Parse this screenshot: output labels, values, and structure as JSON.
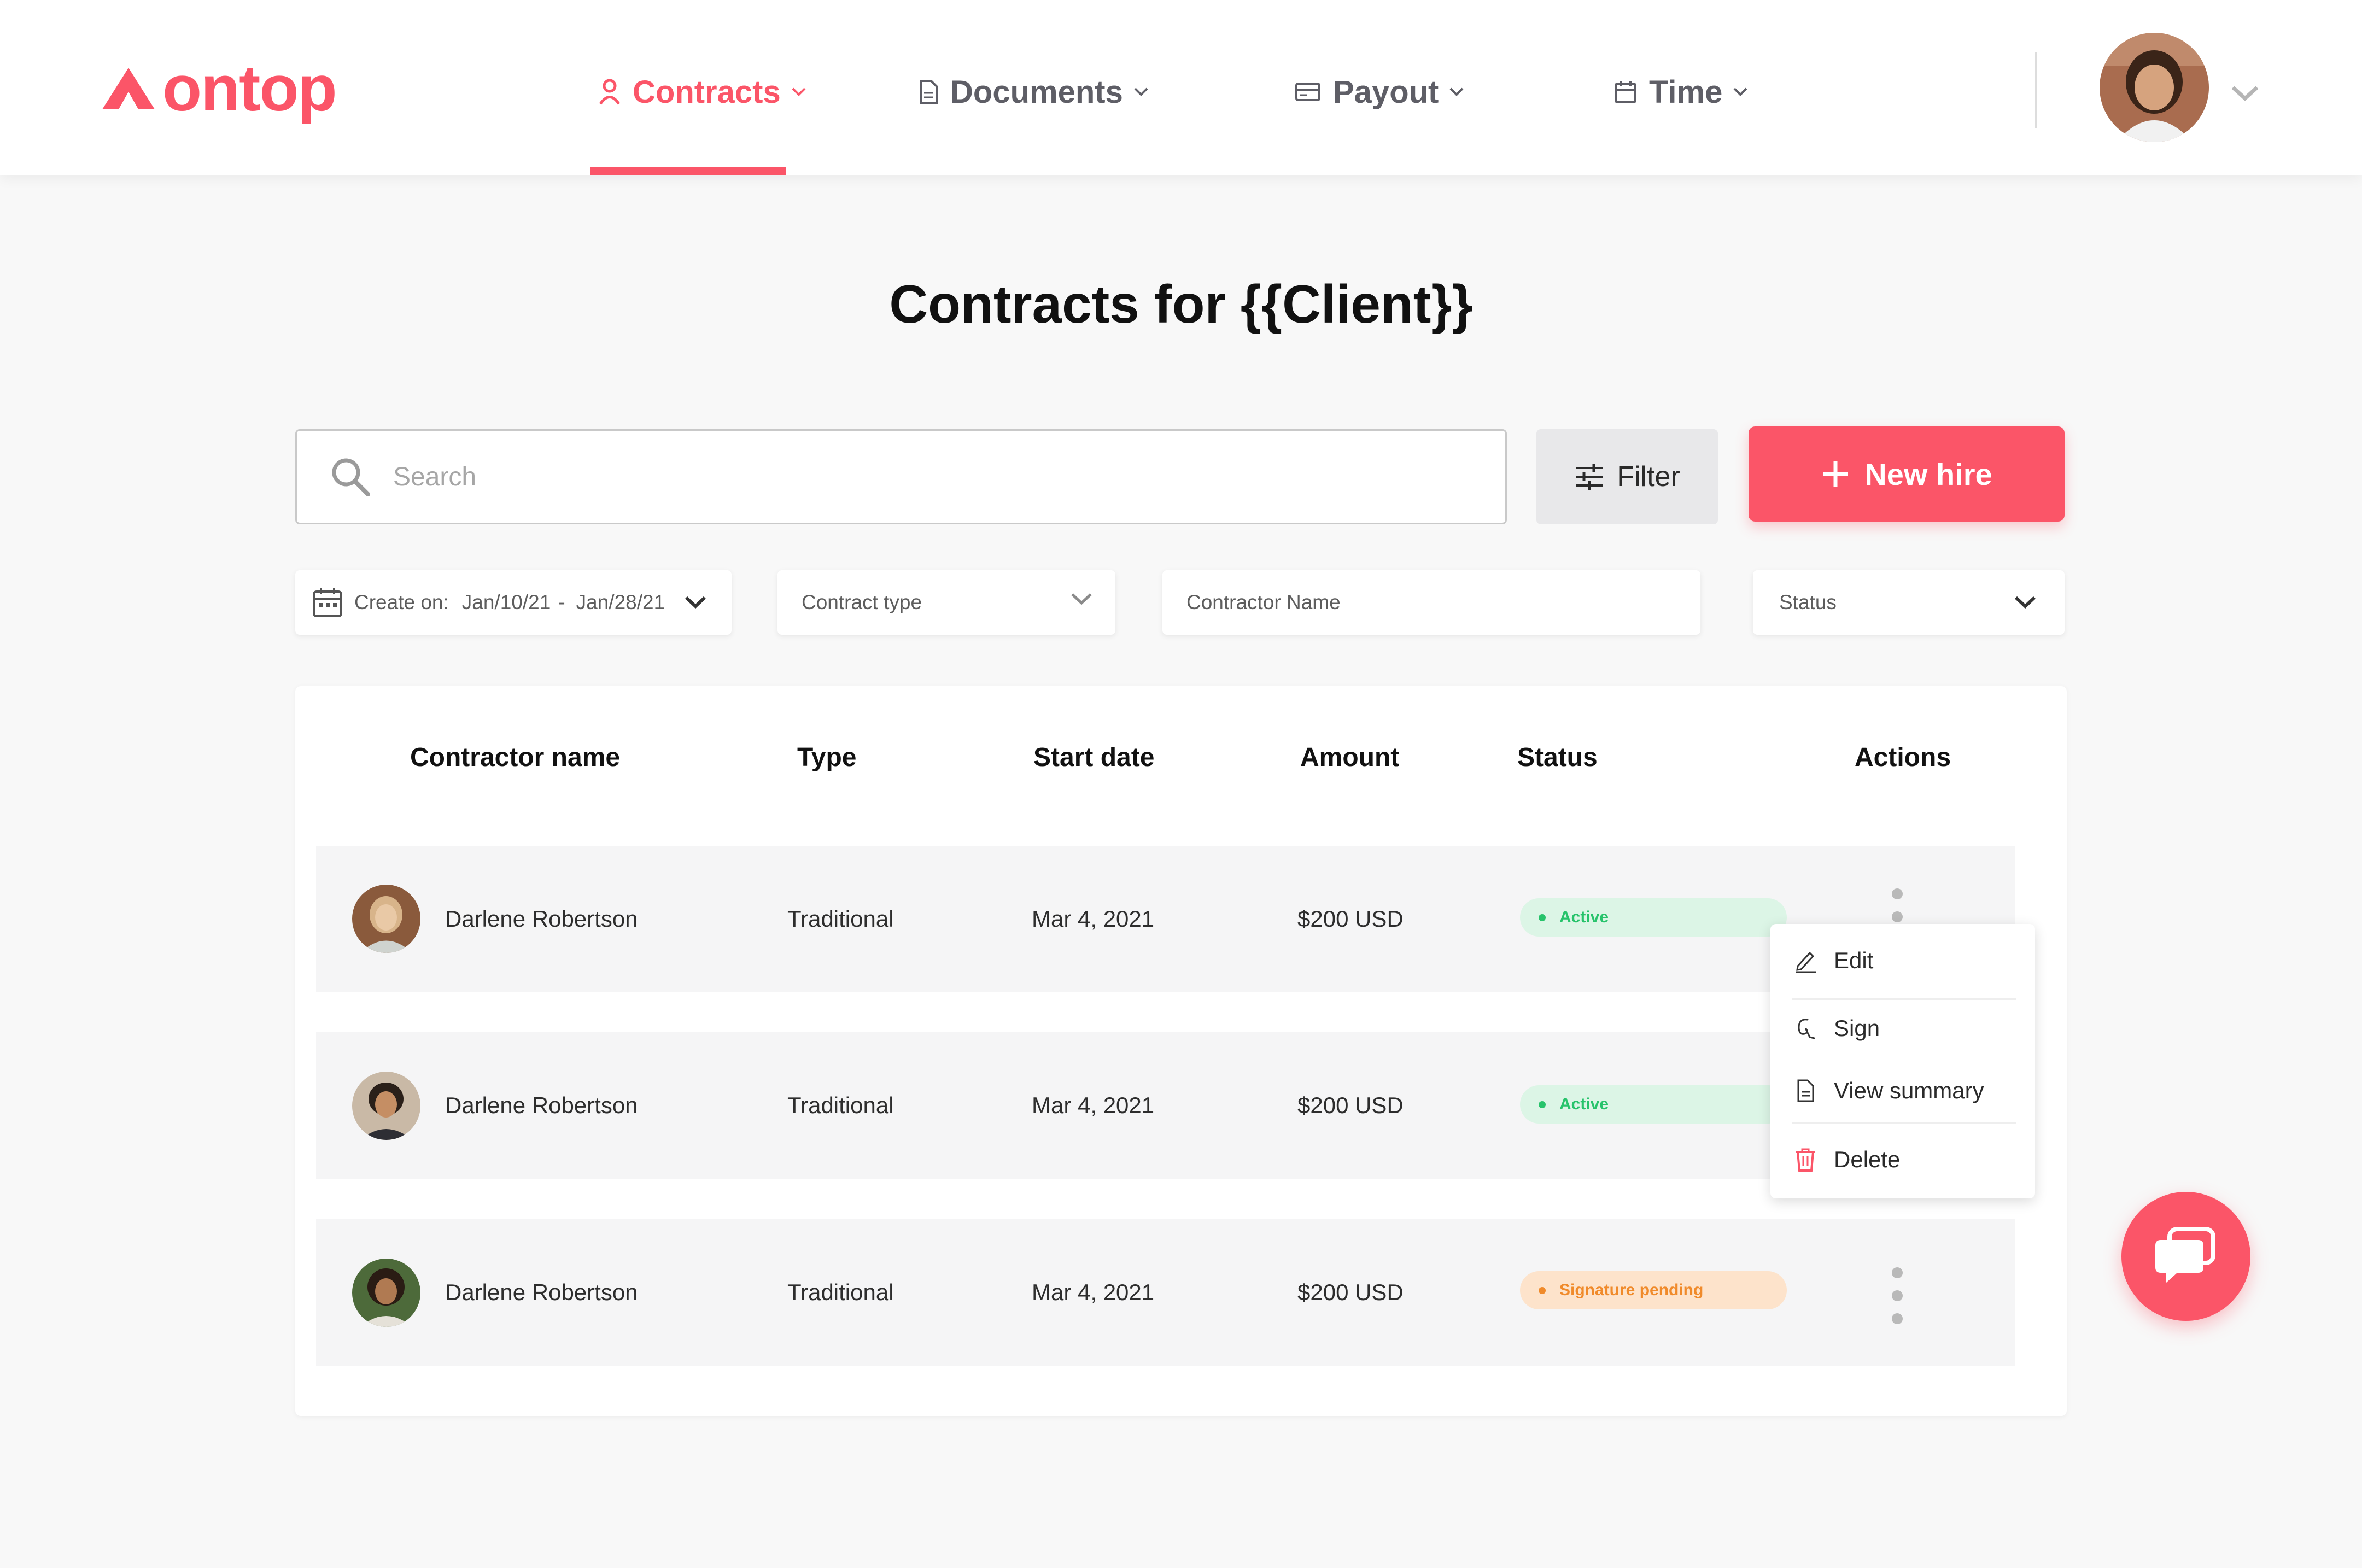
{
  "brand": {
    "name": "ontop",
    "accent": "#fb5568"
  },
  "nav": {
    "items": [
      {
        "label": "Contracts",
        "icon": "person-icon",
        "active": true
      },
      {
        "label": "Documents",
        "icon": "document-icon",
        "active": false
      },
      {
        "label": "Payout",
        "icon": "card-icon",
        "active": false
      },
      {
        "label": "Time",
        "icon": "calendar-icon",
        "active": false
      }
    ]
  },
  "page": {
    "title": "Contracts for {{Client}}"
  },
  "toolbar": {
    "search_placeholder": "Search",
    "filter_label": "Filter",
    "new_hire_label": "New hire"
  },
  "filters": {
    "created_on_label": "Create on:",
    "date_from": "Jan/10/21",
    "date_sep": "-",
    "date_to": "Jan/28/21",
    "contract_type_placeholder": "Contract type",
    "contractor_name_placeholder": "Contractor Name",
    "status_placeholder": "Status"
  },
  "table": {
    "columns": [
      "Contractor name",
      "Type",
      "Start date",
      "Amount",
      "Status",
      "Actions"
    ],
    "rows": [
      {
        "name": "Darlene Robertson",
        "type": "Traditional",
        "start_date": "Mar 4, 2021",
        "amount": "$200 USD",
        "status": "Active",
        "status_kind": "active"
      },
      {
        "name": "Darlene Robertson",
        "type": "Traditional",
        "start_date": "Mar 4, 2021",
        "amount": "$200 USD",
        "status": "Active",
        "status_kind": "active"
      },
      {
        "name": "Darlene Robertson",
        "type": "Traditional",
        "start_date": "Mar 4, 2021",
        "amount": "$200 USD",
        "status": "Signature pending",
        "status_kind": "pending"
      }
    ]
  },
  "actions_menu": {
    "items": [
      {
        "label": "Edit",
        "icon": "pencil-icon"
      },
      {
        "label": "Sign",
        "icon": "signature-icon"
      },
      {
        "label": "View summary",
        "icon": "document-icon"
      },
      {
        "label": "Delete",
        "icon": "trash-icon"
      }
    ]
  },
  "colors": {
    "active_bg": "#dcf5e6",
    "active_fg": "#27c36b",
    "pending_bg": "#fde3cb",
    "pending_fg": "#f08a2a",
    "delete_icon": "#fb5568"
  }
}
